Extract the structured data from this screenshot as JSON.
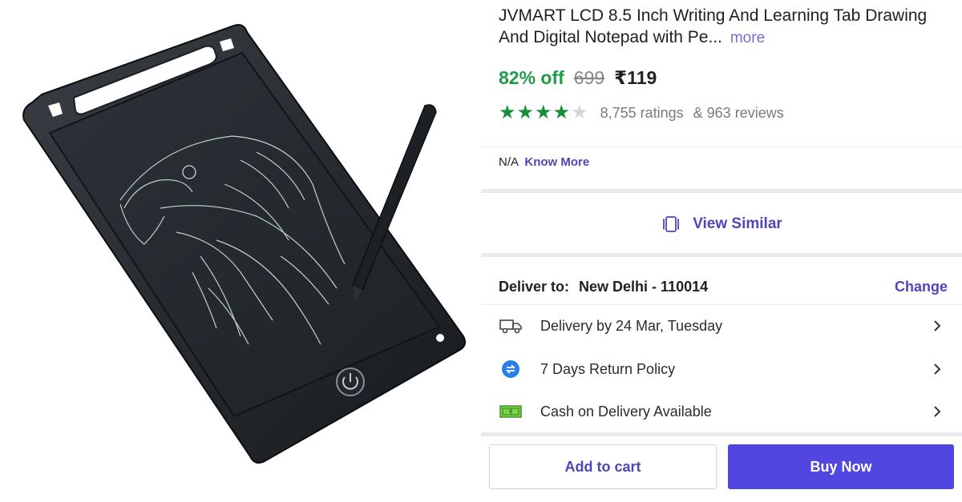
{
  "product": {
    "title": "JVMART LCD 8.5 Inch Writing And Learning Tab Drawing And Digital Notepad with Pe...",
    "more_label": "more"
  },
  "price": {
    "discount": "82% off",
    "mrp": "699",
    "final": "₹119"
  },
  "rating": {
    "stars_value": 4,
    "stars_max": 5,
    "ratings_text": "8,755 ratings",
    "reviews_text": "& 963 reviews"
  },
  "seller_note": {
    "value": "N/A",
    "link": "Know More"
  },
  "view_similar": {
    "label": "View Similar",
    "icon": "view-similar-icon"
  },
  "delivery": {
    "label": "Deliver to:",
    "location": "New Delhi - 110014",
    "change_label": "Change",
    "items": [
      {
        "icon": "truck-icon",
        "text": "Delivery by 24 Mar, Tuesday"
      },
      {
        "icon": "return-icon",
        "text": "7 Days Return Policy"
      },
      {
        "icon": "cash-icon",
        "text": "Cash on Delivery Available"
      }
    ]
  },
  "actions": {
    "add_to_cart": "Add to cart",
    "buy_now": "Buy Now"
  },
  "colors": {
    "accent": "#5147e0",
    "link": "#5145b8",
    "discount_green": "#1e9c47",
    "star_green": "#168f3a"
  }
}
